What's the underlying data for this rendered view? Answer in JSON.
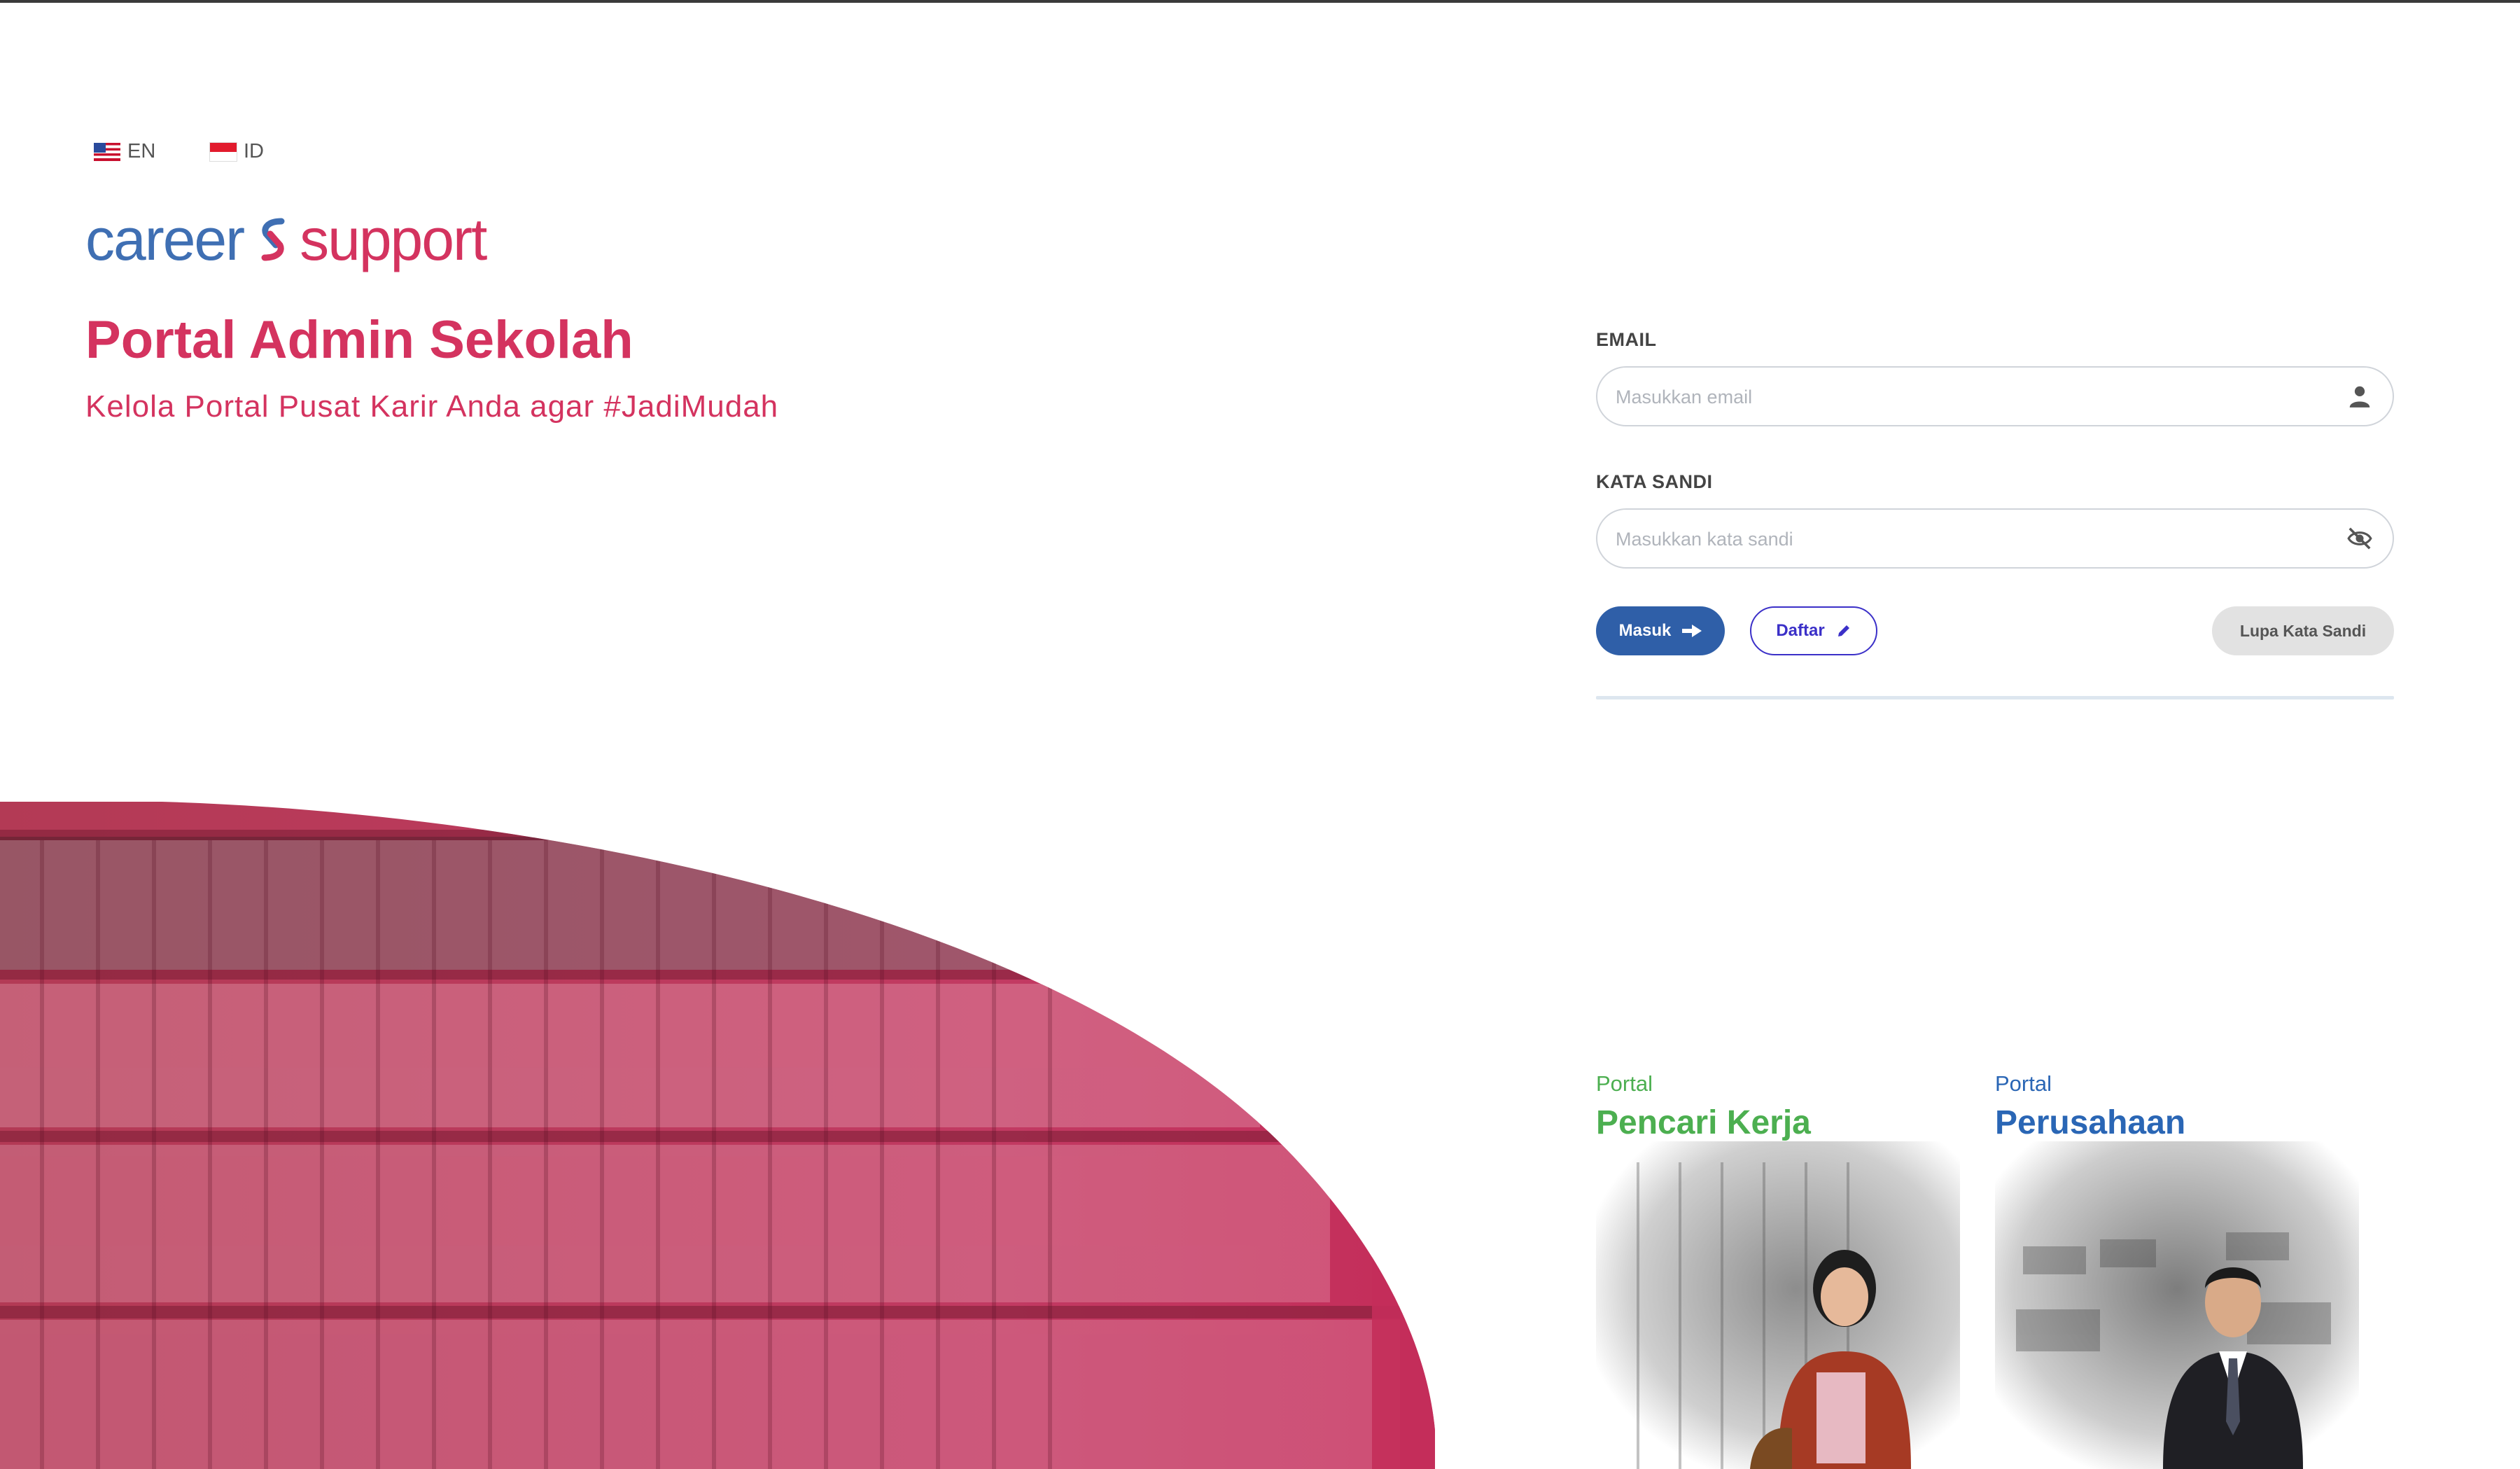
{
  "languages": [
    {
      "code": "EN",
      "flag": "us-flag-icon"
    },
    {
      "code": "ID",
      "flag": "id-flag-icon"
    }
  ],
  "logo": {
    "word1": "career",
    "word2": "support",
    "color_primary": "#3f6fb3",
    "color_accent": "#d4335f"
  },
  "header": {
    "title": "Portal Admin Sekolah",
    "subtitle": "Kelola Portal Pusat Karir Anda agar #JadiMudah"
  },
  "form": {
    "email_label": "EMAIL",
    "email_placeholder": "Masukkan email",
    "email_icon": "user-icon",
    "password_label": "KATA SANDI",
    "password_placeholder": "Masukkan kata sandi",
    "password_icon": "eye-off-icon",
    "login_button": "Masuk",
    "register_button": "Daftar",
    "forgot_button": "Lupa Kata Sandi"
  },
  "portals": [
    {
      "kicker": "Portal",
      "name": "Pencari Kerja",
      "color": "#4caf50"
    },
    {
      "kicker": "Portal",
      "name": "Perusahaan",
      "color": "#2a66b5"
    }
  ],
  "colors": {
    "brand_pink": "#d4335f",
    "brand_blue": "#2f5fa8",
    "register_purple": "#3b30c8"
  }
}
